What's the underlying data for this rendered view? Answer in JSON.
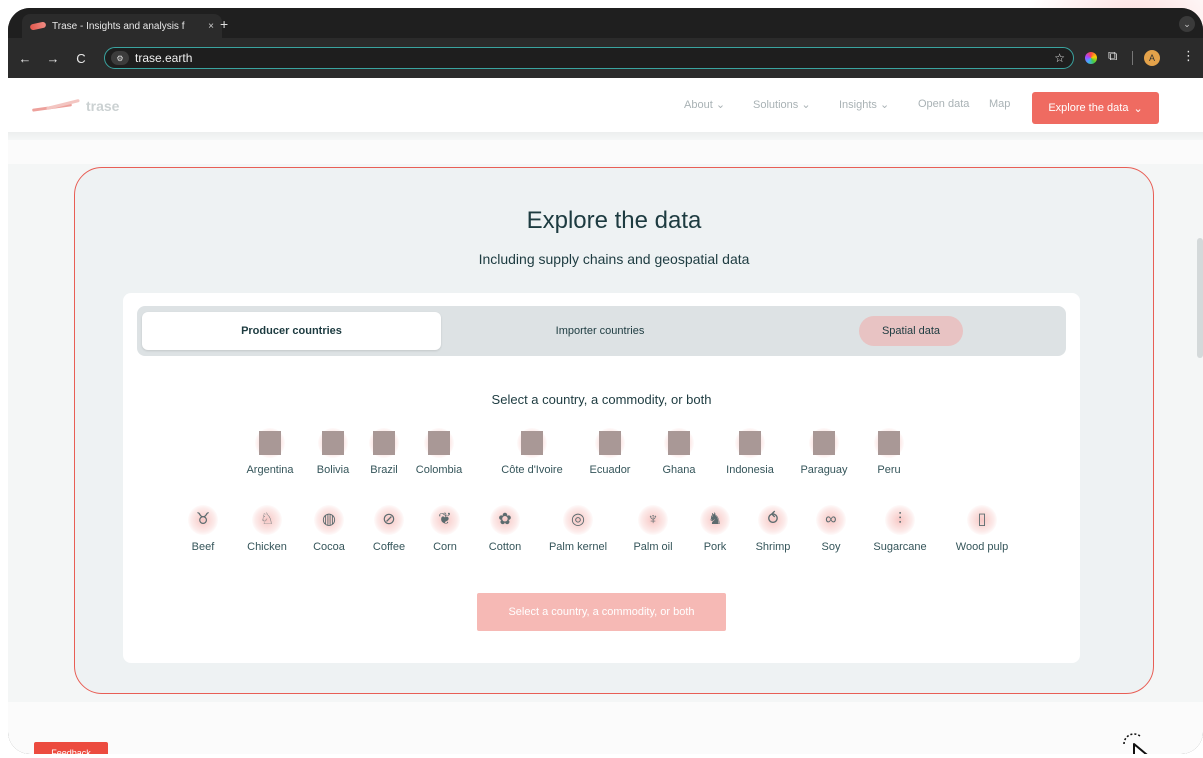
{
  "browser": {
    "tab_title": "Trase - Insights and analysis f",
    "tab_close": "×",
    "new_tab": "+",
    "url": "trase.earth",
    "nav": {
      "back": "←",
      "forward": "→",
      "reload": "C"
    },
    "star": "☆",
    "extension_puzzle": "⧉",
    "menu": "⋮",
    "tabs_menu": "⌄",
    "site_info_icon": "⚙"
  },
  "header": {
    "brand": "trase",
    "menu": [
      "About",
      "Solutions",
      "Insights",
      "Open data",
      "Map"
    ],
    "explore_button": "Explore the data",
    "chevron": "⌄"
  },
  "hero": {
    "title": "Explore the data",
    "subtitle": "Including supply chains and geospatial data"
  },
  "tabs": {
    "producer": "Producer countries",
    "importer": "Importer countries",
    "spatial": "Spatial data"
  },
  "select_label": "Select a country, a commodity, or both",
  "countries": [
    "Argentina",
    "Bolivia",
    "Brazil",
    "Colombia",
    "Côte d'Ivoire",
    "Ecuador",
    "Ghana",
    "Indonesia",
    "Paraguay",
    "Peru"
  ],
  "commodities": [
    "Beef",
    "Chicken",
    "Cocoa",
    "Coffee",
    "Corn",
    "Cotton",
    "Palm kernel",
    "Palm oil",
    "Pork",
    "Shrimp",
    "Soy",
    "Sugarcane",
    "Wood pulp"
  ],
  "commodity_icons": [
    "cow-icon",
    "chicken-icon",
    "cocoa-icon",
    "coffee-bean-icon",
    "corn-icon",
    "cotton-icon",
    "palm-kernel-icon",
    "palm-tree-icon",
    "pig-icon",
    "shrimp-icon",
    "soy-icon",
    "sugarcane-icon",
    "wood-pulp-icon"
  ],
  "commodity_glyphs": [
    "♉",
    "♘",
    "◍",
    "⊘",
    "❦",
    "✿",
    "◎",
    "♆",
    "♞",
    "⥀",
    "∞",
    "⫶",
    "▯"
  ],
  "cta": "Select a country, a commodity, or both",
  "feedback": "Feedback",
  "colors": {
    "accent": "#ef6b61",
    "highlight_border": "#e85e55",
    "text_dark": "#1d3b40"
  }
}
